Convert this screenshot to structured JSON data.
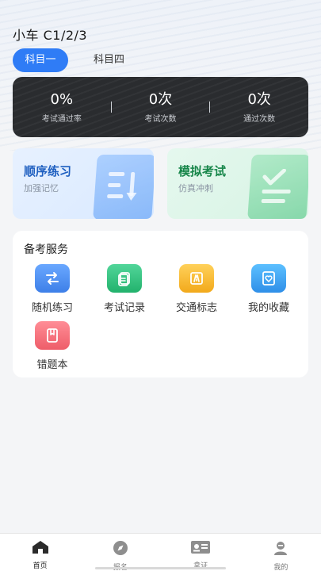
{
  "header": {
    "title": "小车 C1/2/3"
  },
  "tabs": [
    {
      "label": "科目一",
      "active": true
    },
    {
      "label": "科目四",
      "active": false
    }
  ],
  "stats": [
    {
      "value": "0%",
      "label": "考试通过率"
    },
    {
      "value": "0次",
      "label": "考试次数"
    },
    {
      "value": "0次",
      "label": "通过次数"
    }
  ],
  "cards": {
    "practice": {
      "title": "顺序练习",
      "subtitle": "加强记忆",
      "icon": "list-icon"
    },
    "exam": {
      "title": "模拟考试",
      "subtitle": "仿真冲刺",
      "icon": "check-list-icon"
    }
  },
  "services": {
    "title": "备考服务",
    "items": [
      {
        "label": "随机练习",
        "icon": "shuffle-icon",
        "color": "#4a8ff0"
      },
      {
        "label": "考试记录",
        "icon": "record-icon",
        "color": "#2ebf7a"
      },
      {
        "label": "交通标志",
        "icon": "road-sign-icon",
        "color": "#f5b82e"
      },
      {
        "label": "我的收藏",
        "icon": "favorite-icon",
        "color": "#3aa0f2"
      },
      {
        "label": "错题本",
        "icon": "wrong-book-icon",
        "color": "#f06f7a"
      }
    ]
  },
  "nav": [
    {
      "label": "首页",
      "icon": "home-icon",
      "active": true
    },
    {
      "label": "报名",
      "icon": "compass-icon",
      "active": false
    },
    {
      "label": "拿证",
      "icon": "license-icon",
      "active": false
    },
    {
      "label": "我的",
      "icon": "profile-icon",
      "active": false
    }
  ]
}
